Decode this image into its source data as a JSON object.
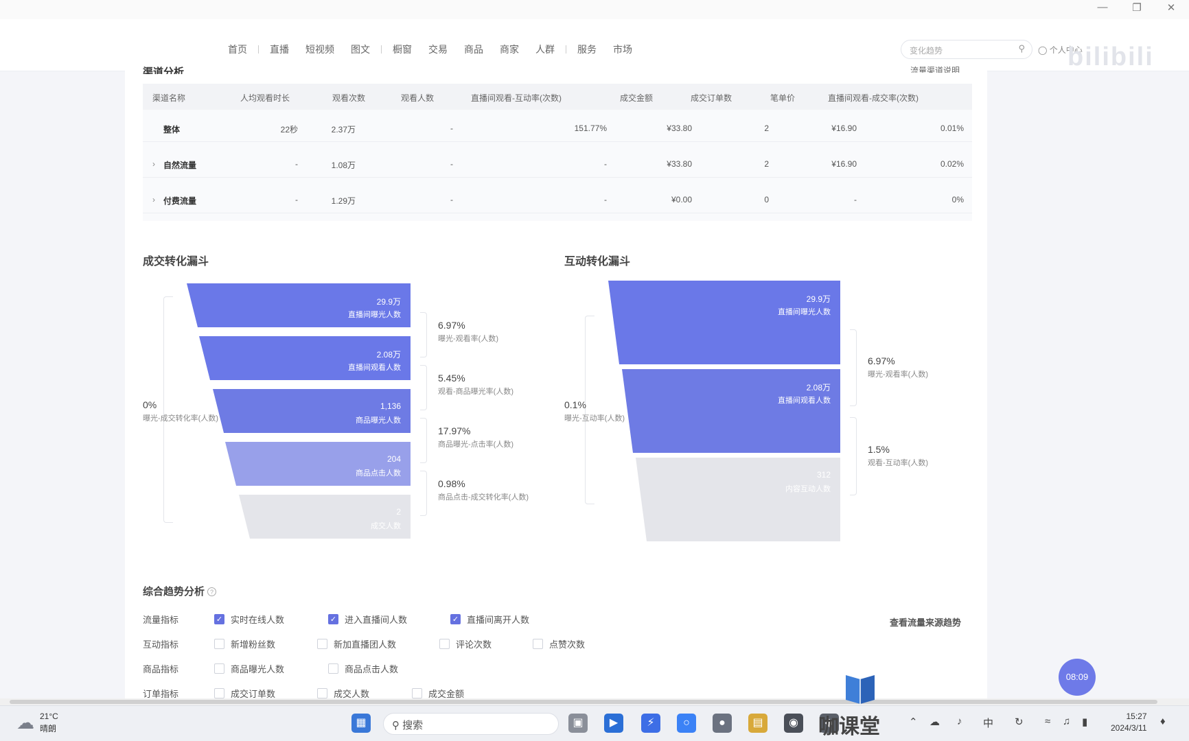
{
  "window": {
    "minimize": "—",
    "restore": "❐",
    "close": "✕"
  },
  "nav": {
    "items": [
      "首页",
      "直播",
      "短视频",
      "图文",
      "橱窗",
      "交易",
      "商品",
      "商家",
      "人群",
      "服务",
      "市场"
    ],
    "search_placeholder": "变化趋势",
    "user": "个人中心",
    "logo_text": "bilibili"
  },
  "channel": {
    "title": "渠道分析",
    "link": "流量渠道说明",
    "headers": [
      "渠道名称",
      "人均观看时长",
      "观看次数",
      "观看人数",
      "直播间观看-互动率(次数)",
      "成交金额",
      "成交订单数",
      "笔单价",
      "直播间观看-成交率(次数)"
    ],
    "rows": [
      {
        "name": "整体",
        "avg_time": "22秒",
        "views": "2.37万",
        "viewers": "-",
        "interact_rate": "151.77%",
        "gmv": "¥33.80",
        "orders": "2",
        "unit_price": "¥16.90",
        "conv_rate": "0.01%"
      },
      {
        "name": "自然流量",
        "avg_time": "-",
        "views": "1.08万",
        "viewers": "-",
        "interact_rate": "-",
        "gmv": "¥33.80",
        "orders": "2",
        "unit_price": "¥16.90",
        "conv_rate": "0.02%"
      },
      {
        "name": "付费流量",
        "avg_time": "-",
        "views": "1.29万",
        "viewers": "-",
        "interact_rate": "-",
        "gmv": "¥0.00",
        "orders": "0",
        "unit_price": "-",
        "conv_rate": "0%"
      }
    ]
  },
  "deal_funnel": {
    "title": "成交转化漏斗",
    "stages": [
      {
        "value": "29.9万",
        "label": "直播间曝光人数",
        "color": "#6a78e8"
      },
      {
        "value": "2.08万",
        "label": "直播间观看人数",
        "color": "#6a78e8"
      },
      {
        "value": "1,136",
        "label": "商品曝光人数",
        "color": "#6e7be4"
      },
      {
        "value": "204",
        "label": "商品点击人数",
        "color": "#98a0ea"
      },
      {
        "value": "2",
        "label": "成交人数",
        "color": "#e4e5ea"
      }
    ],
    "rates": [
      {
        "pct": "6.97%",
        "label": "曝光-观看率(人数)"
      },
      {
        "pct": "5.45%",
        "label": "观看-商品曝光率(人数)"
      },
      {
        "pct": "17.97%",
        "label": "商品曝光-点击率(人数)"
      },
      {
        "pct": "0.98%",
        "label": "商品点击-成交转化率(人数)"
      }
    ],
    "overall": {
      "pct": "0%",
      "label": "曝光-成交转化率(人数)"
    }
  },
  "interact_funnel": {
    "title": "互动转化漏斗",
    "stages": [
      {
        "value": "29.9万",
        "label": "直播间曝光人数",
        "color": "#6a78e8"
      },
      {
        "value": "2.08万",
        "label": "直播间观看人数",
        "color": "#6e7be4"
      },
      {
        "value": "312",
        "label": "内容互动人数",
        "color": "#e4e5ea"
      }
    ],
    "rates": [
      {
        "pct": "6.97%",
        "label": "曝光-观看率(人数)"
      },
      {
        "pct": "1.5%",
        "label": "观看-互动率(人数)"
      }
    ],
    "overall": {
      "pct": "0.1%",
      "label": "曝光-互动率(人数)"
    }
  },
  "trend": {
    "title": "综合趋势分析",
    "link": "查看流量来源趋势",
    "groups": [
      {
        "label": "流量指标",
        "options": [
          {
            "text": "实时在线人数",
            "checked": true
          },
          {
            "text": "进入直播间人数",
            "checked": true
          },
          {
            "text": "直播间离开人数",
            "checked": true
          }
        ]
      },
      {
        "label": "互动指标",
        "options": [
          {
            "text": "新增粉丝数",
            "checked": false
          },
          {
            "text": "新加直播团人数",
            "checked": false
          },
          {
            "text": "评论次数",
            "checked": false
          },
          {
            "text": "点赞次数",
            "checked": false
          }
        ]
      },
      {
        "label": "商品指标",
        "options": [
          {
            "text": "商品曝光人数",
            "checked": false
          },
          {
            "text": "商品点击人数",
            "checked": false
          }
        ]
      },
      {
        "label": "订单指标",
        "options": [
          {
            "text": "成交订单数",
            "checked": false
          },
          {
            "text": "成交人数",
            "checked": false
          },
          {
            "text": "成交金额",
            "checked": false
          }
        ]
      }
    ]
  },
  "timer": "08:09",
  "taskbar": {
    "temp": "21°C",
    "weather": "晴朗",
    "search": "搜索",
    "ime": "中",
    "time": "15:27",
    "date": "2024/3/11"
  },
  "brand_overlay": "咖课堂"
}
